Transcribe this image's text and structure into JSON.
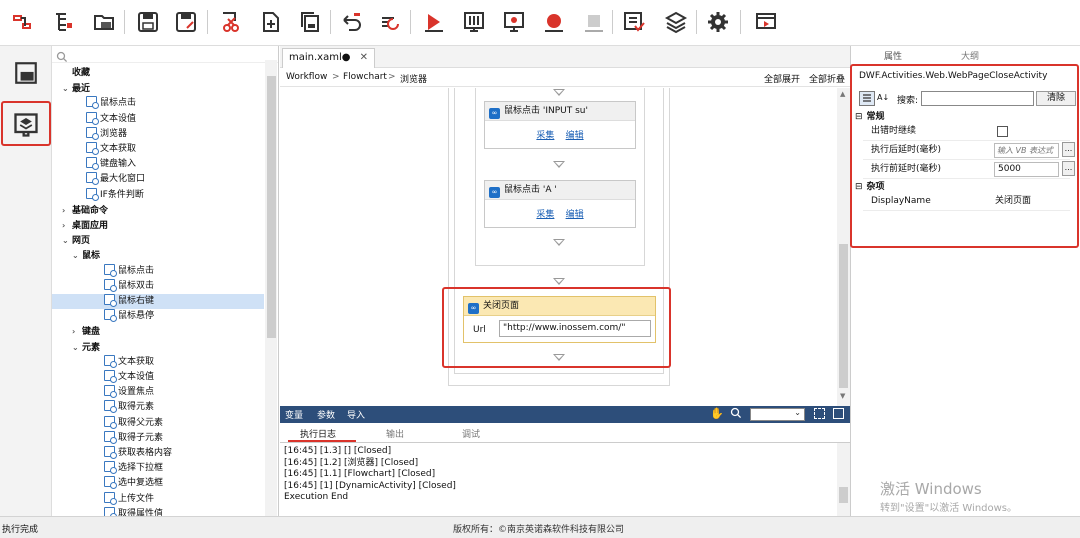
{
  "toolbar": {
    "icons": [
      "connect-icon",
      "tree-icon",
      "folders-icon",
      "save-icon",
      "save-as-icon",
      "cut-icon",
      "add-icon",
      "copy-icon",
      "undo-icon",
      "redo-icon",
      "run-icon",
      "debug-icon",
      "monitor-icon",
      "record-icon",
      "stop-icon",
      "checklist-icon",
      "layers-icon",
      "settings-icon",
      "video-icon"
    ]
  },
  "tree": {
    "items": [
      {
        "label": "收藏",
        "kind": "group"
      },
      {
        "label": "最近",
        "kind": "group"
      },
      {
        "label": "鼠标点击",
        "kind": "leaf"
      },
      {
        "label": "文本设值",
        "kind": "leaf"
      },
      {
        "label": "浏览器",
        "kind": "leaf"
      },
      {
        "label": "文本获取",
        "kind": "leaf"
      },
      {
        "label": "键盘输入",
        "kind": "leaf"
      },
      {
        "label": "最大化窗口",
        "kind": "leaf"
      },
      {
        "label": "IF条件判断",
        "kind": "leaf"
      },
      {
        "label": "基础命令",
        "kind": "group"
      },
      {
        "label": "桌面应用",
        "kind": "group"
      },
      {
        "label": "网页",
        "kind": "group"
      },
      {
        "label": "鼠标",
        "kind": "sub"
      },
      {
        "label": "鼠标点击",
        "kind": "leaf2"
      },
      {
        "label": "鼠标双击",
        "kind": "leaf2"
      },
      {
        "label": "鼠标右键",
        "kind": "leaf2"
      },
      {
        "label": "鼠标悬停",
        "kind": "leaf2"
      },
      {
        "label": "键盘",
        "kind": "sub"
      },
      {
        "label": "元素",
        "kind": "sub"
      },
      {
        "label": "文本获取",
        "kind": "leaf2"
      },
      {
        "label": "文本设值",
        "kind": "leaf2"
      },
      {
        "label": "设置焦点",
        "kind": "leaf2"
      },
      {
        "label": "取得元素",
        "kind": "leaf2"
      },
      {
        "label": "取得父元素",
        "kind": "leaf2"
      },
      {
        "label": "取得子元素",
        "kind": "leaf2"
      },
      {
        "label": "获取表格内容",
        "kind": "leaf2"
      },
      {
        "label": "选择下拉框",
        "kind": "leaf2"
      },
      {
        "label": "选中复选框",
        "kind": "leaf2"
      },
      {
        "label": "上传文件",
        "kind": "leaf2"
      },
      {
        "label": "取得属性值",
        "kind": "leaf2"
      }
    ]
  },
  "editor": {
    "tab_label": "main.xaml●",
    "tab_close": "✕",
    "breadcrumb": [
      "Workflow",
      "Flowchart",
      "浏览器"
    ],
    "breadcrumb_sep": ">",
    "expand_all": "全部展开",
    "collapse_all": "全部折叠",
    "act1_title": "鼠标点击 'INPUT su'",
    "act2_title": "鼠标点击 'A '",
    "collect": "采集",
    "edit": "编辑",
    "close_page_title": "关闭页面",
    "url_label": "Url",
    "url_value": "\"http://www.inossem.com/\""
  },
  "bottom": {
    "tabs": [
      "变量",
      "参数",
      "导入"
    ],
    "log_tabs": [
      "执行日志",
      "输出",
      "调试"
    ],
    "log_lines": [
      "[16:45] [1.3] [] [Closed]",
      "[16:45] [1.2] [浏览器] [Closed]",
      "[16:45] [1.1] [Flowchart] [Closed]",
      "[16:45] [1] [DynamicActivity] [Closed]",
      "Execution End"
    ]
  },
  "props": {
    "tab_props": "属性",
    "tab_outline": "大纲",
    "type_name": "DWF.Activities.Web.WebPageCloseActivity",
    "search_label": "搜索:",
    "clear_button": "清除",
    "cat_general": "常规",
    "cat_misc": "杂项",
    "rows": [
      {
        "name": "出错时继续",
        "value": ""
      },
      {
        "name": "执行后延时(毫秒)",
        "value": "",
        "placeholder": "输入 VB 表达式"
      },
      {
        "name": "执行前延时(毫秒)",
        "value": "5000"
      }
    ],
    "display_name_label": "DisplayName",
    "display_name_value": "关闭页面",
    "ellipsis": "..."
  },
  "watermark": {
    "line1": "激活 Windows",
    "line2": "转到\"设置\"以激活 Windows。"
  },
  "status": {
    "left": "执行完成",
    "center": "版权所有：©南京英诺森软件科技有限公司"
  },
  "colors": {
    "accent": "#1e6fc7",
    "highlight": "#d9342b",
    "selected_row": "#cfe1f6",
    "bottom_bar": "#2d4e7a",
    "activity_highlight_head": "#fbe8b3"
  }
}
